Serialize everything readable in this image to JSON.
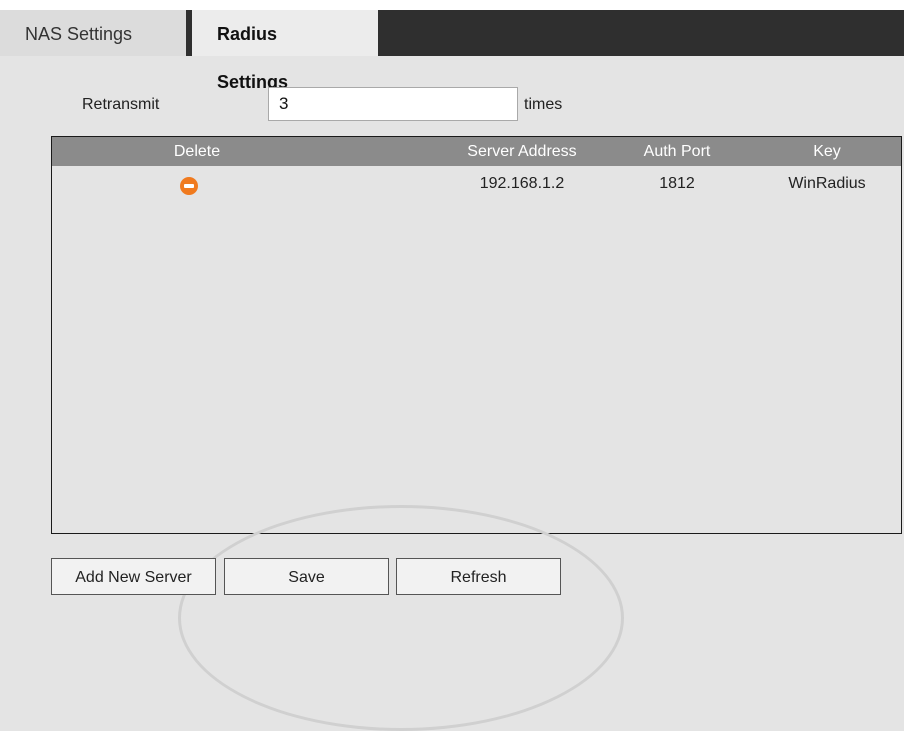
{
  "tabs": [
    {
      "label": "NAS Settings",
      "active": false
    },
    {
      "label": "Radius Settings",
      "active": true
    }
  ],
  "retransmit": {
    "label": "Retransmit",
    "value": "3",
    "unit": "times"
  },
  "table": {
    "columns": [
      "Delete",
      "Server Address",
      "Auth Port",
      "Key"
    ],
    "rows": [
      {
        "delete_icon": "minus-circle-icon",
        "server_address": "192.168.1.2",
        "auth_port": "1812",
        "key": "WinRadius"
      }
    ]
  },
  "buttons": {
    "add_new_server": "Add New Server",
    "save": "Save",
    "refresh": "Refresh"
  },
  "colors": {
    "delete_icon": "#f07a1e",
    "header_bg": "#8b8b8b",
    "tabbar_bg": "#2f2f2f"
  }
}
